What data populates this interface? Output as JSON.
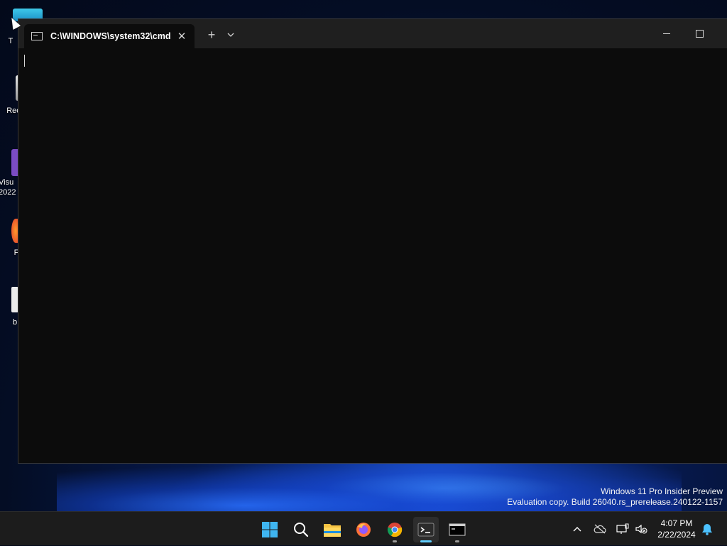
{
  "desktop": {
    "icons": [
      {
        "label": "T"
      },
      {
        "label": "Rec"
      },
      {
        "label": "Visu\n2022"
      },
      {
        "label": "F"
      },
      {
        "label": "b"
      }
    ],
    "watermark": {
      "line1": "Windows 11 Pro Insider Preview",
      "line2": "Evaluation copy. Build 26040.rs_prerelease.240122-1157"
    }
  },
  "terminal": {
    "tab_title": "C:\\WINDOWS\\system32\\cmd.",
    "close_glyph": "✕",
    "new_tab_glyph": "+",
    "background": "#0c0c0c",
    "titlebar_color": "#1f1f1f"
  },
  "taskbar": {
    "apps": [
      {
        "name": "start-button-icon"
      },
      {
        "name": "search-icon"
      },
      {
        "name": "file-explorer-icon"
      },
      {
        "name": "firefox-icon"
      },
      {
        "name": "chrome-icon"
      },
      {
        "name": "terminal-icon"
      },
      {
        "name": "cmd-icon"
      }
    ],
    "clock": {
      "time": "4:07 PM",
      "date": "2/22/2024"
    },
    "accent": "#60cdff"
  }
}
